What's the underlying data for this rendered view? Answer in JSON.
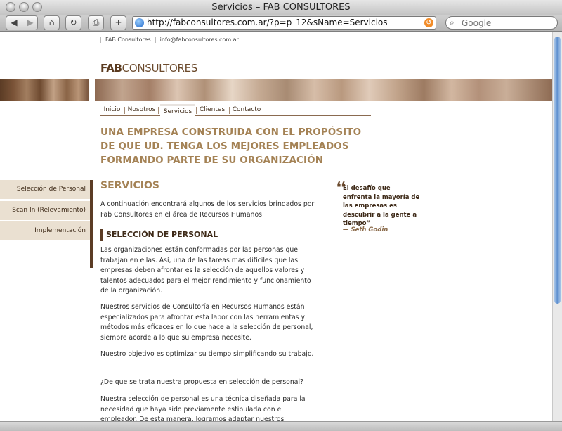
{
  "window": {
    "title": "Servicios – FAB CONSULTORES"
  },
  "toolbar": {
    "url": "http://fabconsultores.com.ar/?p=p_12&sName=Servicios",
    "search_placeholder": "Google",
    "back_glyph": "◀",
    "forward_glyph": "▶",
    "home_glyph": "⌂",
    "reload_glyph": "↻",
    "print_glyph": "⎙",
    "add_glyph": "+"
  },
  "page": {
    "top_links": [
      "FAB Consultores",
      "info@fabconsultores.com.ar"
    ],
    "logo": {
      "bold": "FAB",
      "light": "CONSULTORES"
    },
    "nav": [
      "Inicio",
      "Nosotros",
      "Servicios",
      "Clientes",
      "Contacto"
    ],
    "nav_active": "Servicios",
    "headline": [
      "UNA EMPRESA CONSTRUIDA CON EL PROPÓSITO",
      "DE QUE UD. TENGA LOS MEJORES EMPLEADOS",
      "FORMANDO PARTE DE SU ORGANIZACIÓN"
    ],
    "side_nav": [
      "Selección de Personal",
      "Scan In (Relevamiento)",
      "Implementación"
    ],
    "servicios_title": "SERVICIOS",
    "intro": "A continuación encontrará algunos de los servicios brindados por Fab Consultores en el área de Recursos Humanos.",
    "section_title": "SELECCIÓN DE PERSONAL",
    "paragraphs": [
      "Las organizaciones están conformadas por las personas que trabajan en ellas. Así, una de las tareas más difíciles que las empresas deben afrontar es la selección de aquellos valores y talentos adecuados para el mejor rendimiento y funcionamiento de la organización.",
      "Nuestros servicios de Consultoría en Recursos Humanos están especializados para afrontar esta labor con las herramientas y métodos más eficaces en lo que hace a la selección de personal, siempre acorde a lo que su empresa necesite.",
      "Nuestro objetivo es optimizar su tiempo simplificando su trabajo.",
      "¿De que se trata nuestra propuesta en selección de personal?",
      "Nuestra selección de personal es una técnica diseñada para la necesidad que haya sido previamente estipulada con el empleador. De esta manera, logramos adaptar nuestros"
    ],
    "quote": {
      "mark": "❛❛",
      "text": "El desafío que enfrenta la mayoría de las empresas es descubrir a la gente a tiempo”",
      "author": "— Seth Godin"
    }
  },
  "colors": {
    "brown_dark": "#5b3c25",
    "gold": "#a48255",
    "side_bg": "#eae0d1"
  }
}
